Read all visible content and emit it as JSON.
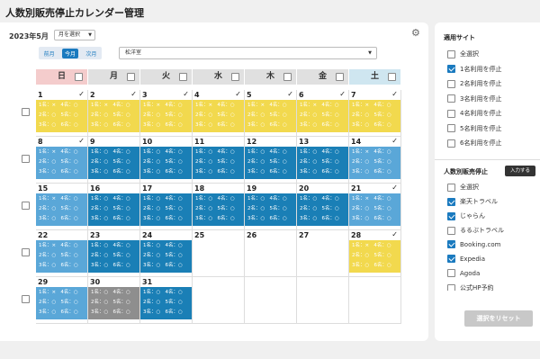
{
  "page_title": "人数別販売停止カレンダー管理",
  "toolbar": {
    "month_label": "2023年5月",
    "month_select": "月を選択",
    "prev": "前月",
    "current": "今月",
    "next": "次月",
    "facility": "松洋室"
  },
  "weekdays": [
    {
      "label": "日",
      "bg": "#f4cccc"
    },
    {
      "label": "月",
      "bg": "#e0e0e0"
    },
    {
      "label": "火",
      "bg": "#e0e0e0"
    },
    {
      "label": "水",
      "bg": "#e0e0e0"
    },
    {
      "label": "木",
      "bg": "#e0e0e0"
    },
    {
      "label": "金",
      "bg": "#e0e0e0"
    },
    {
      "label": "土",
      "bg": "#cfe6f0"
    }
  ],
  "calendar": {
    "days": [
      {
        "d": "1",
        "s": "y",
        "c": true
      },
      {
        "d": "2",
        "s": "y",
        "c": true
      },
      {
        "d": "3",
        "s": "y",
        "c": true
      },
      {
        "d": "4",
        "s": "y",
        "c": true
      },
      {
        "d": "5",
        "s": "y",
        "c": true
      },
      {
        "d": "6",
        "s": "y",
        "c": true
      },
      {
        "d": "7",
        "s": "y",
        "c": true
      },
      {
        "d": "8",
        "s": "b",
        "c": true
      },
      {
        "d": "9",
        "s": "d",
        "c": false
      },
      {
        "d": "10",
        "s": "d",
        "c": false
      },
      {
        "d": "11",
        "s": "d",
        "c": false
      },
      {
        "d": "12",
        "s": "d",
        "c": false
      },
      {
        "d": "13",
        "s": "d",
        "c": false
      },
      {
        "d": "14",
        "s": "b",
        "c": true
      },
      {
        "d": "15",
        "s": "b",
        "c": false
      },
      {
        "d": "16",
        "s": "d",
        "c": false
      },
      {
        "d": "17",
        "s": "d",
        "c": false
      },
      {
        "d": "18",
        "s": "d",
        "c": false
      },
      {
        "d": "19",
        "s": "d",
        "c": false
      },
      {
        "d": "20",
        "s": "d",
        "c": false
      },
      {
        "d": "21",
        "s": "b",
        "c": true
      },
      {
        "d": "22",
        "s": "b",
        "c": false
      },
      {
        "d": "23",
        "s": "d",
        "c": false
      },
      {
        "d": "24",
        "s": "d",
        "c": false
      },
      {
        "d": "25",
        "s": "",
        "c": false
      },
      {
        "d": "26",
        "s": "",
        "c": false
      },
      {
        "d": "27",
        "s": "",
        "c": false
      },
      {
        "d": "28",
        "s": "y",
        "c": true
      },
      {
        "d": "29",
        "s": "b",
        "c": false
      },
      {
        "d": "30",
        "s": "g",
        "c": false
      },
      {
        "d": "31",
        "s": "d",
        "c": false
      },
      {
        "d": "",
        "s": "",
        "c": false
      },
      {
        "d": "",
        "s": "",
        "c": false
      },
      {
        "d": "",
        "s": "",
        "c": false
      },
      {
        "d": "",
        "s": "",
        "c": false
      }
    ],
    "pattern_x": "1名：×   4名：○\n2名：○   5名：○\n3名：○   6名：○",
    "pattern_o": "1名：○   4名：○\n2名：○   5名：○\n3名：○   6名：○"
  },
  "sites": {
    "title": "適用サイト",
    "items": [
      {
        "label": "全選択",
        "checked": false
      },
      {
        "label": "1名利用を停止",
        "checked": true
      },
      {
        "label": "2名利用を停止",
        "checked": false
      },
      {
        "label": "3名利用を停止",
        "checked": false
      },
      {
        "label": "4名利用を停止",
        "checked": false
      },
      {
        "label": "5名利用を停止",
        "checked": false
      },
      {
        "label": "6名利用を停止",
        "checked": false
      }
    ]
  },
  "stop": {
    "title": "人数別販売停止",
    "input_button": "入力する",
    "items": [
      {
        "label": "全選択",
        "checked": false
      },
      {
        "label": "楽天トラベル",
        "checked": true
      },
      {
        "label": "じゃらん",
        "checked": true
      },
      {
        "label": "るるぶトラベル",
        "checked": false
      },
      {
        "label": "Booking.com",
        "checked": true
      },
      {
        "label": "Expedia",
        "checked": true
      },
      {
        "label": "Agoda",
        "checked": false
      },
      {
        "label": "公式HP予約",
        "checked": false
      }
    ],
    "reset": "選択をリセット"
  }
}
